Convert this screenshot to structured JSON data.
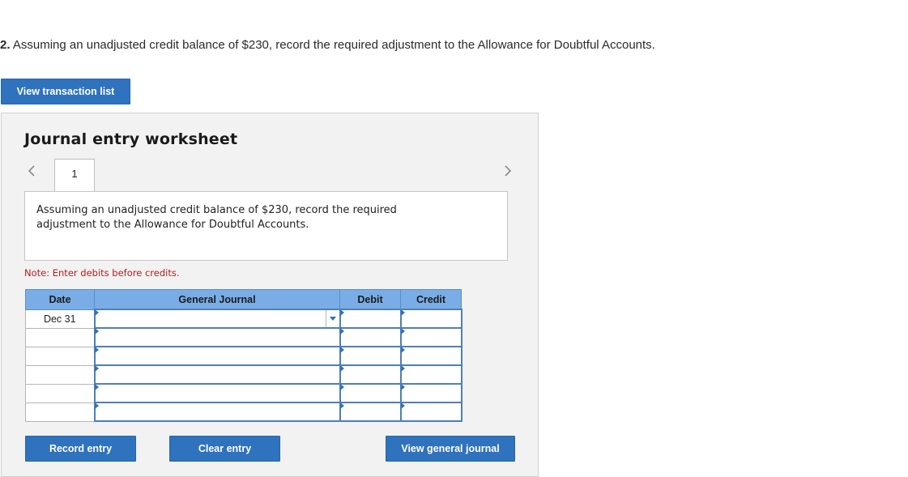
{
  "question": {
    "number": "2.",
    "text": " Assuming an unadjusted credit balance of $230, record the required adjustment to the Allowance for Doubtful Accounts."
  },
  "buttons": {
    "view_transaction_list": "View transaction list",
    "record_entry": "Record entry",
    "clear_entry": "Clear entry",
    "view_general_journal": "View general journal"
  },
  "worksheet": {
    "title": "Journal entry worksheet",
    "tabs": [
      {
        "label": "1"
      }
    ],
    "instruction": "Assuming an unadjusted credit balance of $230, record the required adjustment to the Allowance for Doubtful Accounts.",
    "note": "Note: Enter debits before credits."
  },
  "table": {
    "headers": {
      "date": "Date",
      "general_journal": "General Journal",
      "debit": "Debit",
      "credit": "Credit"
    },
    "rows": [
      {
        "date": "Dec 31",
        "account": "",
        "debit": "",
        "credit": ""
      },
      {
        "date": "",
        "account": "",
        "debit": "",
        "credit": ""
      },
      {
        "date": "",
        "account": "",
        "debit": "",
        "credit": ""
      },
      {
        "date": "",
        "account": "",
        "debit": "",
        "credit": ""
      },
      {
        "date": "",
        "account": "",
        "debit": "",
        "credit": ""
      },
      {
        "date": "",
        "account": "",
        "debit": "",
        "credit": ""
      }
    ]
  },
  "colors": {
    "button_blue": "#2f72bd",
    "header_blue": "#7aade6",
    "note_red": "#b22020",
    "panel_bg": "#f2f2f2"
  }
}
